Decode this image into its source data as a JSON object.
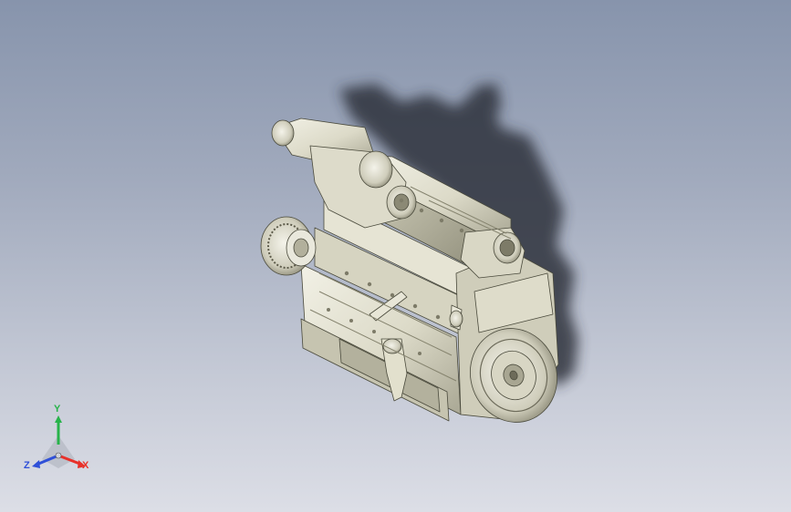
{
  "view": {
    "background_top": "#8794ac",
    "background_bottom": "#dcdee6",
    "model_color": "#e2e0cf",
    "model_shade_color": "#b9b7a3",
    "shadow_color": "#2b2f38"
  },
  "triad": {
    "x_label": "X",
    "y_label": "Y",
    "z_label": "Z",
    "x_color": "#e8312a",
    "y_color": "#27b34a",
    "z_color": "#2f50d8"
  }
}
